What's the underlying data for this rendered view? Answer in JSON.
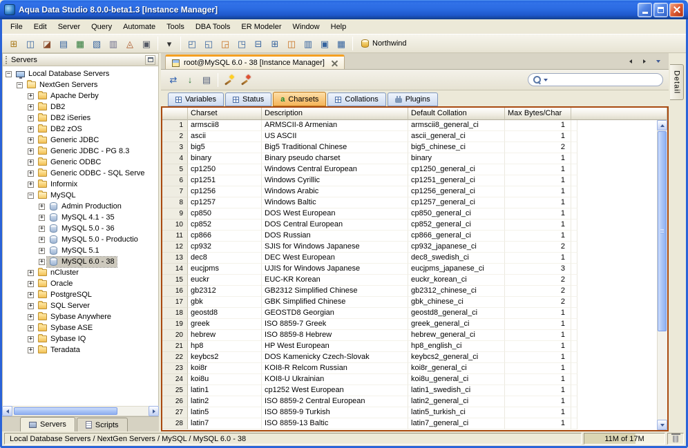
{
  "window": {
    "title": "Aqua Data Studio 8.0.0-beta1.3 [Instance Manager]"
  },
  "menu": {
    "items": [
      "File",
      "Edit",
      "Server",
      "Query",
      "Automate",
      "Tools",
      "DBA Tools",
      "ER Modeler",
      "Window",
      "Help"
    ]
  },
  "toolbar": {
    "groups": [
      {
        "icons": [
          {
            "name": "register-server",
            "glyph": "⊞",
            "color": "#A87818"
          },
          {
            "name": "connect-server",
            "glyph": "◫",
            "color": "#35639E"
          },
          {
            "name": "disconnect-server",
            "glyph": "◪",
            "color": "#8A4A2A"
          },
          {
            "name": "schema-browser",
            "glyph": "▤",
            "color": "#35639E"
          },
          {
            "name": "query-analyzer",
            "glyph": "▦",
            "color": "#2F7A3A"
          },
          {
            "name": "query-builder",
            "glyph": "▧",
            "color": "#35639E"
          },
          {
            "name": "table-data-editor",
            "glyph": "▥",
            "color": "#6A6A8A"
          },
          {
            "name": "er-modeler",
            "glyph": "◬",
            "color": "#A85020"
          },
          {
            "name": "script-editor",
            "glyph": "▣",
            "color": "#555A66"
          }
        ]
      },
      {
        "icons": [
          {
            "name": "open-window-dropdown",
            "glyph": "▾",
            "color": "#333333"
          }
        ]
      },
      {
        "icons": [
          {
            "name": "results-grid",
            "glyph": "◰",
            "color": "#35639E"
          },
          {
            "name": "results-text",
            "glyph": "◱",
            "color": "#35639E"
          },
          {
            "name": "results-form",
            "glyph": "◲",
            "color": "#C87020"
          },
          {
            "name": "results-pivot",
            "glyph": "◳",
            "color": "#35639E"
          },
          {
            "name": "split-horizontal",
            "glyph": "⊟",
            "color": "#35639E"
          },
          {
            "name": "split-vertical",
            "glyph": "⊞",
            "color": "#35639E"
          },
          {
            "name": "window-cascade",
            "glyph": "◫",
            "color": "#C87020"
          },
          {
            "name": "window-tile",
            "glyph": "▥",
            "color": "#35639E"
          },
          {
            "name": "window-maximize",
            "glyph": "▣",
            "color": "#35639E"
          },
          {
            "name": "auto-commit",
            "glyph": "▦",
            "color": "#35639E"
          }
        ]
      }
    ],
    "database_label": "Northwind"
  },
  "sidebar": {
    "title": "Servers",
    "tree": [
      {
        "label": "Local Database Servers",
        "depth": 0,
        "exp": "minus",
        "icon": "network"
      },
      {
        "label": "NextGen Servers",
        "depth": 1,
        "exp": "minus",
        "icon": "folder-open"
      },
      {
        "label": "Apache Derby",
        "depth": 2,
        "exp": "plus",
        "icon": "folder"
      },
      {
        "label": "DB2",
        "depth": 2,
        "exp": "plus",
        "icon": "folder"
      },
      {
        "label": "DB2 iSeries",
        "depth": 2,
        "exp": "plus",
        "icon": "folder"
      },
      {
        "label": "DB2 zOS",
        "depth": 2,
        "exp": "plus",
        "icon": "folder"
      },
      {
        "label": "Generic JDBC",
        "depth": 2,
        "exp": "plus",
        "icon": "folder"
      },
      {
        "label": "Generic JDBC - PG 8.3",
        "depth": 2,
        "exp": "plus",
        "icon": "folder"
      },
      {
        "label": "Generic ODBC",
        "depth": 2,
        "exp": "plus",
        "icon": "folder"
      },
      {
        "label": "Generic ODBC - SQL Serve",
        "depth": 2,
        "exp": "plus",
        "icon": "folder"
      },
      {
        "label": "Informix",
        "depth": 2,
        "exp": "plus",
        "icon": "folder"
      },
      {
        "label": "MySQL",
        "depth": 2,
        "exp": "minus",
        "icon": "folder-open"
      },
      {
        "label": "Admin Production",
        "depth": 3,
        "exp": "plus",
        "icon": "db"
      },
      {
        "label": "MySQL 4.1 - 35",
        "depth": 3,
        "exp": "plus",
        "icon": "db"
      },
      {
        "label": "MySQL 5.0 - 36",
        "depth": 3,
        "exp": "plus",
        "icon": "db"
      },
      {
        "label": "MySQL 5.0 - Productio",
        "depth": 3,
        "exp": "plus",
        "icon": "db"
      },
      {
        "label": "MySQL 5.1",
        "depth": 3,
        "exp": "plus",
        "icon": "db"
      },
      {
        "label": "MySQL 6.0 - 38",
        "depth": 3,
        "exp": "plus",
        "icon": "db",
        "selected": true
      },
      {
        "label": "nCluster",
        "depth": 2,
        "exp": "plus",
        "icon": "folder"
      },
      {
        "label": "Oracle",
        "depth": 2,
        "exp": "plus",
        "icon": "folder"
      },
      {
        "label": "PostgreSQL",
        "depth": 2,
        "exp": "plus",
        "icon": "folder"
      },
      {
        "label": "SQL Server",
        "depth": 2,
        "exp": "plus",
        "icon": "folder"
      },
      {
        "label": "Sybase Anywhere",
        "depth": 2,
        "exp": "plus",
        "icon": "folder"
      },
      {
        "label": "Sybase ASE",
        "depth": 2,
        "exp": "plus",
        "icon": "folder"
      },
      {
        "label": "Sybase IQ",
        "depth": 2,
        "exp": "plus",
        "icon": "folder"
      },
      {
        "label": "Teradata",
        "depth": 2,
        "exp": "plus",
        "icon": "folder"
      }
    ],
    "tabs": [
      {
        "label": "Servers",
        "icon": "server",
        "active": true
      },
      {
        "label": "Scripts",
        "icon": "script",
        "active": false
      }
    ]
  },
  "main": {
    "doc_tab": {
      "label": "root@MySQL 6.0 - 38 [Instance Manager]"
    },
    "side_tab": "Detail",
    "toolbar": {
      "groups": [
        {
          "icons": [
            {
              "name": "refresh",
              "glyph": "⇄",
              "color": "#2F5FAF"
            },
            {
              "name": "export-results",
              "glyph": "↓",
              "color": "#2F7A3A"
            },
            {
              "name": "print-results",
              "glyph": "▤",
              "color": "#55607A"
            }
          ]
        },
        {
          "icons": [
            {
              "name": "format-wand",
              "css": "ic-wand"
            },
            {
              "name": "filter-wand",
              "css": "ic-wand red"
            }
          ]
        }
      ]
    },
    "search": {
      "value": ""
    },
    "subtabs": [
      {
        "label": "Variables",
        "icon": "grid"
      },
      {
        "label": "Status",
        "icon": "grid"
      },
      {
        "label": "Charsets",
        "icon": "charset",
        "icon_glyph": "a",
        "active": true
      },
      {
        "label": "Collations",
        "icon": "grid"
      },
      {
        "label": "Plugins",
        "icon": "plug"
      }
    ],
    "table": {
      "columns": [
        "Charset",
        "Description",
        "Default Collation",
        "Max Bytes/Char"
      ],
      "rows": [
        [
          "armscii8",
          "ARMSCII-8 Armenian",
          "armscii8_general_ci",
          "1"
        ],
        [
          "ascii",
          "US ASCII",
          "ascii_general_ci",
          "1"
        ],
        [
          "big5",
          "Big5 Traditional Chinese",
          "big5_chinese_ci",
          "2"
        ],
        [
          "binary",
          "Binary pseudo charset",
          "binary",
          "1"
        ],
        [
          "cp1250",
          "Windows Central European",
          "cp1250_general_ci",
          "1"
        ],
        [
          "cp1251",
          "Windows Cyrillic",
          "cp1251_general_ci",
          "1"
        ],
        [
          "cp1256",
          "Windows Arabic",
          "cp1256_general_ci",
          "1"
        ],
        [
          "cp1257",
          "Windows Baltic",
          "cp1257_general_ci",
          "1"
        ],
        [
          "cp850",
          "DOS West European",
          "cp850_general_ci",
          "1"
        ],
        [
          "cp852",
          "DOS Central European",
          "cp852_general_ci",
          "1"
        ],
        [
          "cp866",
          "DOS Russian",
          "cp866_general_ci",
          "1"
        ],
        [
          "cp932",
          "SJIS for Windows Japanese",
          "cp932_japanese_ci",
          "2"
        ],
        [
          "dec8",
          "DEC West European",
          "dec8_swedish_ci",
          "1"
        ],
        [
          "eucjpms",
          "UJIS for Windows Japanese",
          "eucjpms_japanese_ci",
          "3"
        ],
        [
          "euckr",
          "EUC-KR Korean",
          "euckr_korean_ci",
          "2"
        ],
        [
          "gb2312",
          "GB2312 Simplified Chinese",
          "gb2312_chinese_ci",
          "2"
        ],
        [
          "gbk",
          "GBK Simplified Chinese",
          "gbk_chinese_ci",
          "2"
        ],
        [
          "geostd8",
          "GEOSTD8 Georgian",
          "geostd8_general_ci",
          "1"
        ],
        [
          "greek",
          "ISO 8859-7 Greek",
          "greek_general_ci",
          "1"
        ],
        [
          "hebrew",
          "ISO 8859-8 Hebrew",
          "hebrew_general_ci",
          "1"
        ],
        [
          "hp8",
          "HP West European",
          "hp8_english_ci",
          "1"
        ],
        [
          "keybcs2",
          "DOS Kamenicky Czech-Slovak",
          "keybcs2_general_ci",
          "1"
        ],
        [
          "koi8r",
          "KOI8-R Relcom Russian",
          "koi8r_general_ci",
          "1"
        ],
        [
          "koi8u",
          "KOI8-U Ukrainian",
          "koi8u_general_ci",
          "1"
        ],
        [
          "latin1",
          "cp1252 West European",
          "latin1_swedish_ci",
          "1"
        ],
        [
          "latin2",
          "ISO 8859-2 Central European",
          "latin2_general_ci",
          "1"
        ],
        [
          "latin5",
          "ISO 8859-9 Turkish",
          "latin5_turkish_ci",
          "1"
        ],
        [
          "latin7",
          "ISO 8859-13 Baltic",
          "latin7_general_ci",
          "1"
        ]
      ]
    }
  },
  "statusbar": {
    "path": "Local Database Servers / NextGen Servers / MySQL / MySQL 6.0 - 38",
    "memory": "11M of 17M"
  }
}
